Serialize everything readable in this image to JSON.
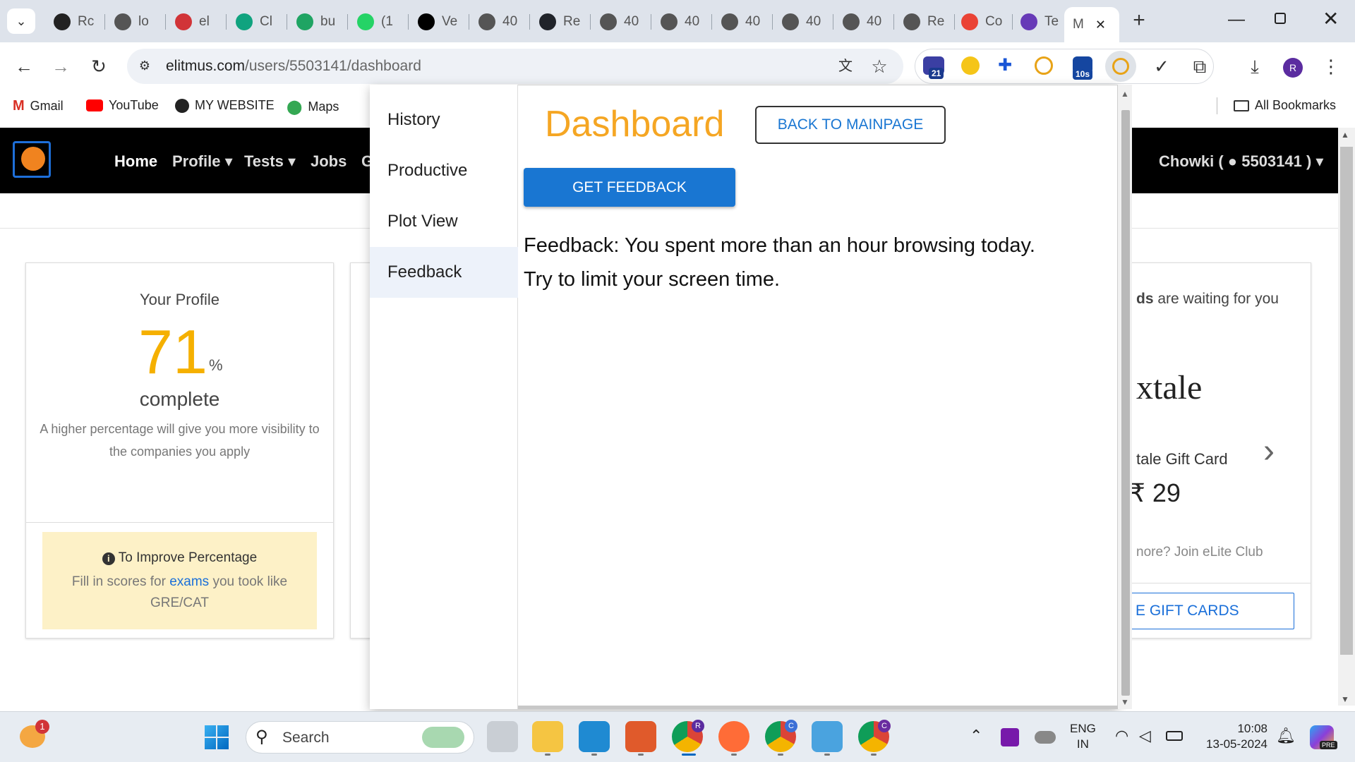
{
  "browser": {
    "tabs": [
      {
        "label": "Rc",
        "icon": "github-icon"
      },
      {
        "label": "lo",
        "icon": "globe-icon"
      },
      {
        "label": "el",
        "icon": "x-icon"
      },
      {
        "label": "Cl",
        "icon": "chatgpt-icon"
      },
      {
        "label": "bu",
        "icon": "drive-icon"
      },
      {
        "label": "(1",
        "icon": "whatsapp-icon"
      },
      {
        "label": "Ve",
        "icon": "vercel-icon"
      },
      {
        "label": "40",
        "icon": "globe-icon"
      },
      {
        "label": "Re",
        "icon": "react-icon"
      },
      {
        "label": "40",
        "icon": "globe-icon"
      },
      {
        "label": "40",
        "icon": "globe-icon"
      },
      {
        "label": "40",
        "icon": "globe-icon"
      },
      {
        "label": "40",
        "icon": "globe-icon"
      },
      {
        "label": "40",
        "icon": "globe-icon"
      },
      {
        "label": "Re",
        "icon": "globe-icon"
      },
      {
        "label": "Co",
        "icon": "gmail-icon"
      },
      {
        "label": "Te",
        "icon": "forms-icon"
      },
      {
        "label": "M",
        "icon": "none",
        "active": true
      }
    ],
    "new_tab_label": "+",
    "url": "elitmus.com/users/5503141/dashboard",
    "url_host": "elitmus.com",
    "url_path": "/users/5503141/dashboard",
    "extension_badges": [
      "21",
      "10s"
    ],
    "profile_initial": "R",
    "bookmarks": [
      "Gmail",
      "YouTube",
      "MY WEBSITE",
      "Maps"
    ],
    "all_bookmarks": "All Bookmarks"
  },
  "site": {
    "nav": [
      "Home",
      "Profile",
      "Tests",
      "Jobs",
      "G"
    ],
    "user_menu": "Chowki (",
    "user_id": "5503141 )",
    "profile_card": {
      "heading": "Your Profile",
      "percent": "71",
      "percent_sign": "%",
      "complete": "complete",
      "hint": "A higher percentage will give you more visibility to the companies you apply",
      "improve_title": "To Improve Percentage",
      "improve_text_1": "Fill in scores for ",
      "improve_link": "exams",
      "improve_text_2": " you took like GRE/CAT"
    },
    "reward_card": {
      "waiting_bold": "ds",
      "waiting_text": " are waiting for you",
      "brand": "xtale",
      "gift_card": "tale Gift Card",
      "price": "₹ 29",
      "join_text": "nore? Join eLite Club",
      "cta": "E GIFT CARDS"
    }
  },
  "popup": {
    "menu": [
      "History",
      "Productive",
      "Plot View",
      "Feedback"
    ],
    "active_menu": "Feedback",
    "title": "Dashboard",
    "back_button": "BACK TO MAINPAGE",
    "feedback_button": "GET FEEDBACK",
    "feedback_line_1": "Feedback: You spent more than an hour browsing today.",
    "feedback_line_2": "Try to limit your screen time."
  },
  "taskbar": {
    "search_placeholder": "Search",
    "weather_badge": "1",
    "lang_1": "ENG",
    "lang_2": "IN",
    "time": "10:08",
    "date": "13-05-2024",
    "chrome_badges": [
      "R",
      "C",
      "C"
    ],
    "copilot_badge": "PRE"
  },
  "colors": {
    "accent_orange": "#f5a623",
    "primary_blue": "#1976d2",
    "site_black": "#000000",
    "improve_bg": "#fdf1c7"
  }
}
